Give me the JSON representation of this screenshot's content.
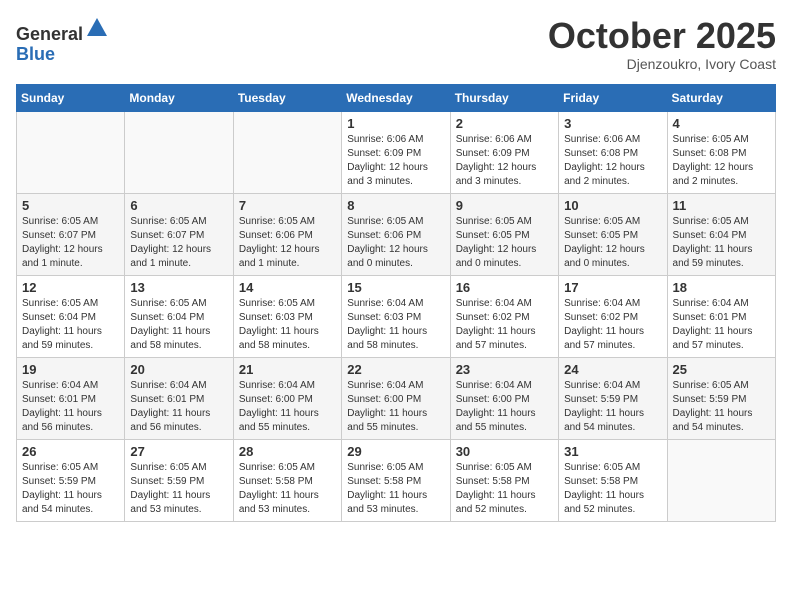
{
  "header": {
    "logo_general": "General",
    "logo_blue": "Blue",
    "month": "October 2025",
    "location": "Djenzoukro, Ivory Coast"
  },
  "days_of_week": [
    "Sunday",
    "Monday",
    "Tuesday",
    "Wednesday",
    "Thursday",
    "Friday",
    "Saturday"
  ],
  "weeks": [
    [
      {
        "num": "",
        "info": ""
      },
      {
        "num": "",
        "info": ""
      },
      {
        "num": "",
        "info": ""
      },
      {
        "num": "1",
        "info": "Sunrise: 6:06 AM\nSunset: 6:09 PM\nDaylight: 12 hours and 3 minutes."
      },
      {
        "num": "2",
        "info": "Sunrise: 6:06 AM\nSunset: 6:09 PM\nDaylight: 12 hours and 3 minutes."
      },
      {
        "num": "3",
        "info": "Sunrise: 6:06 AM\nSunset: 6:08 PM\nDaylight: 12 hours and 2 minutes."
      },
      {
        "num": "4",
        "info": "Sunrise: 6:05 AM\nSunset: 6:08 PM\nDaylight: 12 hours and 2 minutes."
      }
    ],
    [
      {
        "num": "5",
        "info": "Sunrise: 6:05 AM\nSunset: 6:07 PM\nDaylight: 12 hours and 1 minute."
      },
      {
        "num": "6",
        "info": "Sunrise: 6:05 AM\nSunset: 6:07 PM\nDaylight: 12 hours and 1 minute."
      },
      {
        "num": "7",
        "info": "Sunrise: 6:05 AM\nSunset: 6:06 PM\nDaylight: 12 hours and 1 minute."
      },
      {
        "num": "8",
        "info": "Sunrise: 6:05 AM\nSunset: 6:06 PM\nDaylight: 12 hours and 0 minutes."
      },
      {
        "num": "9",
        "info": "Sunrise: 6:05 AM\nSunset: 6:05 PM\nDaylight: 12 hours and 0 minutes."
      },
      {
        "num": "10",
        "info": "Sunrise: 6:05 AM\nSunset: 6:05 PM\nDaylight: 12 hours and 0 minutes."
      },
      {
        "num": "11",
        "info": "Sunrise: 6:05 AM\nSunset: 6:04 PM\nDaylight: 11 hours and 59 minutes."
      }
    ],
    [
      {
        "num": "12",
        "info": "Sunrise: 6:05 AM\nSunset: 6:04 PM\nDaylight: 11 hours and 59 minutes."
      },
      {
        "num": "13",
        "info": "Sunrise: 6:05 AM\nSunset: 6:04 PM\nDaylight: 11 hours and 58 minutes."
      },
      {
        "num": "14",
        "info": "Sunrise: 6:05 AM\nSunset: 6:03 PM\nDaylight: 11 hours and 58 minutes."
      },
      {
        "num": "15",
        "info": "Sunrise: 6:04 AM\nSunset: 6:03 PM\nDaylight: 11 hours and 58 minutes."
      },
      {
        "num": "16",
        "info": "Sunrise: 6:04 AM\nSunset: 6:02 PM\nDaylight: 11 hours and 57 minutes."
      },
      {
        "num": "17",
        "info": "Sunrise: 6:04 AM\nSunset: 6:02 PM\nDaylight: 11 hours and 57 minutes."
      },
      {
        "num": "18",
        "info": "Sunrise: 6:04 AM\nSunset: 6:01 PM\nDaylight: 11 hours and 57 minutes."
      }
    ],
    [
      {
        "num": "19",
        "info": "Sunrise: 6:04 AM\nSunset: 6:01 PM\nDaylight: 11 hours and 56 minutes."
      },
      {
        "num": "20",
        "info": "Sunrise: 6:04 AM\nSunset: 6:01 PM\nDaylight: 11 hours and 56 minutes."
      },
      {
        "num": "21",
        "info": "Sunrise: 6:04 AM\nSunset: 6:00 PM\nDaylight: 11 hours and 55 minutes."
      },
      {
        "num": "22",
        "info": "Sunrise: 6:04 AM\nSunset: 6:00 PM\nDaylight: 11 hours and 55 minutes."
      },
      {
        "num": "23",
        "info": "Sunrise: 6:04 AM\nSunset: 6:00 PM\nDaylight: 11 hours and 55 minutes."
      },
      {
        "num": "24",
        "info": "Sunrise: 6:04 AM\nSunset: 5:59 PM\nDaylight: 11 hours and 54 minutes."
      },
      {
        "num": "25",
        "info": "Sunrise: 6:05 AM\nSunset: 5:59 PM\nDaylight: 11 hours and 54 minutes."
      }
    ],
    [
      {
        "num": "26",
        "info": "Sunrise: 6:05 AM\nSunset: 5:59 PM\nDaylight: 11 hours and 54 minutes."
      },
      {
        "num": "27",
        "info": "Sunrise: 6:05 AM\nSunset: 5:59 PM\nDaylight: 11 hours and 53 minutes."
      },
      {
        "num": "28",
        "info": "Sunrise: 6:05 AM\nSunset: 5:58 PM\nDaylight: 11 hours and 53 minutes."
      },
      {
        "num": "29",
        "info": "Sunrise: 6:05 AM\nSunset: 5:58 PM\nDaylight: 11 hours and 53 minutes."
      },
      {
        "num": "30",
        "info": "Sunrise: 6:05 AM\nSunset: 5:58 PM\nDaylight: 11 hours and 52 minutes."
      },
      {
        "num": "31",
        "info": "Sunrise: 6:05 AM\nSunset: 5:58 PM\nDaylight: 11 hours and 52 minutes."
      },
      {
        "num": "",
        "info": ""
      }
    ]
  ]
}
